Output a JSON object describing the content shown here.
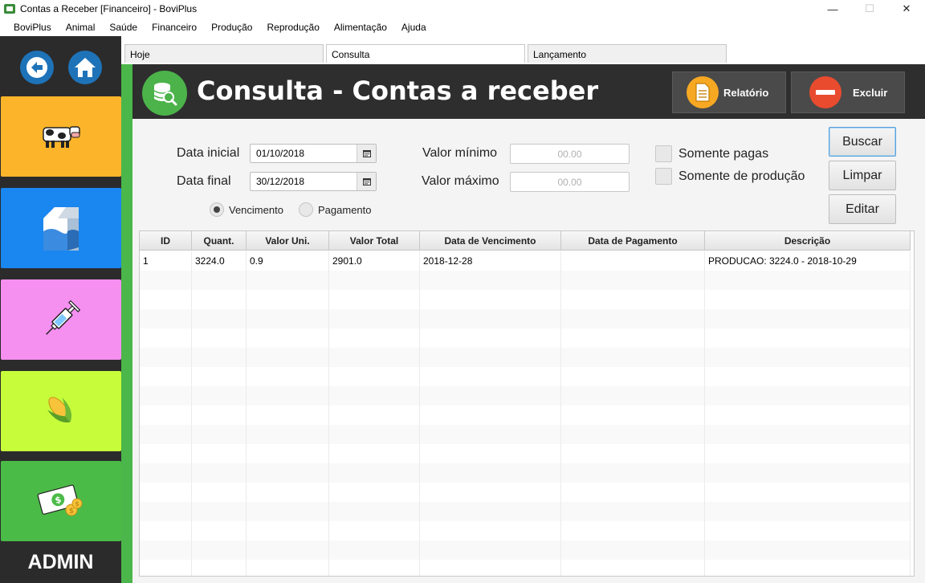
{
  "window": {
    "title": "Contas a Receber [Financeiro] - BoviPlus",
    "controls": {
      "minimize": "—",
      "maximize": "☐",
      "close": "✕"
    }
  },
  "menu": [
    "BoviPlus",
    "Animal",
    "Saúde",
    "Financeiro",
    "Produção",
    "Reprodução",
    "Alimentação",
    "Ajuda"
  ],
  "sidebar": {
    "tiles": [
      {
        "name": "cattle",
        "icon": "cow-icon",
        "color": "#fcb52a"
      },
      {
        "name": "milk",
        "icon": "milk-carton-icon",
        "color": "#1a86f0"
      },
      {
        "name": "health",
        "icon": "syringe-icon",
        "color": "#f58ff0"
      },
      {
        "name": "feed",
        "icon": "corn-icon",
        "color": "#c7fc3b"
      },
      {
        "name": "finance",
        "icon": "money-icon",
        "color": "#4bbb48"
      }
    ],
    "user": "ADMIN"
  },
  "tabs": [
    "Hoje",
    "Consulta",
    "Lançamento"
  ],
  "header": {
    "title": "Consulta - Contas a receber",
    "report_label": "Relatório",
    "delete_label": "Excluir"
  },
  "form": {
    "start_date_label": "Data inicial",
    "start_date": "01/10/2018",
    "end_date_label": "Data final",
    "end_date": "30/12/2018",
    "min_value_label": "Valor mínimo",
    "min_value_placeholder": "00.00",
    "max_value_label": "Valor máximo",
    "max_value_placeholder": "00.00",
    "radio_due": "Vencimento",
    "radio_payment": "Pagamento",
    "selected_radio": "Vencimento",
    "only_paid": "Somente pagas",
    "only_production": "Somente de produção",
    "search_label": "Buscar",
    "clear_label": "Limpar",
    "edit_label": "Editar"
  },
  "table": {
    "columns": [
      "ID",
      "Quant.",
      "Valor Uni.",
      "Valor Total",
      "Data de Vencimento",
      "Data de Pagamento",
      "Descrição"
    ],
    "rows": [
      [
        "1",
        "3224.0",
        "0.9",
        "2901.0",
        "2018-12-28",
        "",
        "PRODUCAO: 3224.0 - 2018-10-29"
      ]
    ]
  }
}
